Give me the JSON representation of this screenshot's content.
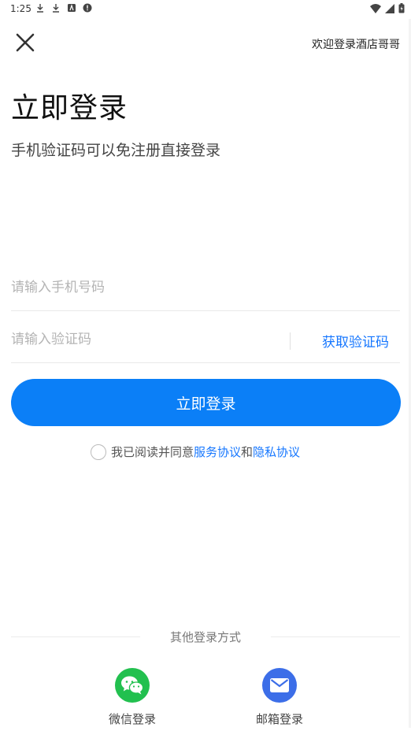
{
  "status": {
    "time": "1:25"
  },
  "header": {
    "welcome": "欢迎登录酒店哥哥"
  },
  "title": "立即登录",
  "subtitle": "手机验证码可以免注册直接登录",
  "form": {
    "phone_placeholder": "请输入手机号码",
    "phone_value": "",
    "code_placeholder": "请输入验证码",
    "code_value": "",
    "get_code": "获取验证码",
    "submit": "立即登录"
  },
  "agreement": {
    "checked": false,
    "prefix": "我已阅读并同意",
    "service_link": "服务协议",
    "and": "和",
    "privacy_link": "隐私协议"
  },
  "other": {
    "heading": "其他登录方式",
    "wechat_label": "微信登录",
    "wechat_icon": "wechat-icon",
    "mail_label": "邮箱登录",
    "mail_icon": "mail-icon"
  },
  "colors": {
    "primary": "#0b7ff7",
    "link": "#1677ff",
    "wechat": "#22c04f",
    "mail": "#3c6ee8"
  }
}
